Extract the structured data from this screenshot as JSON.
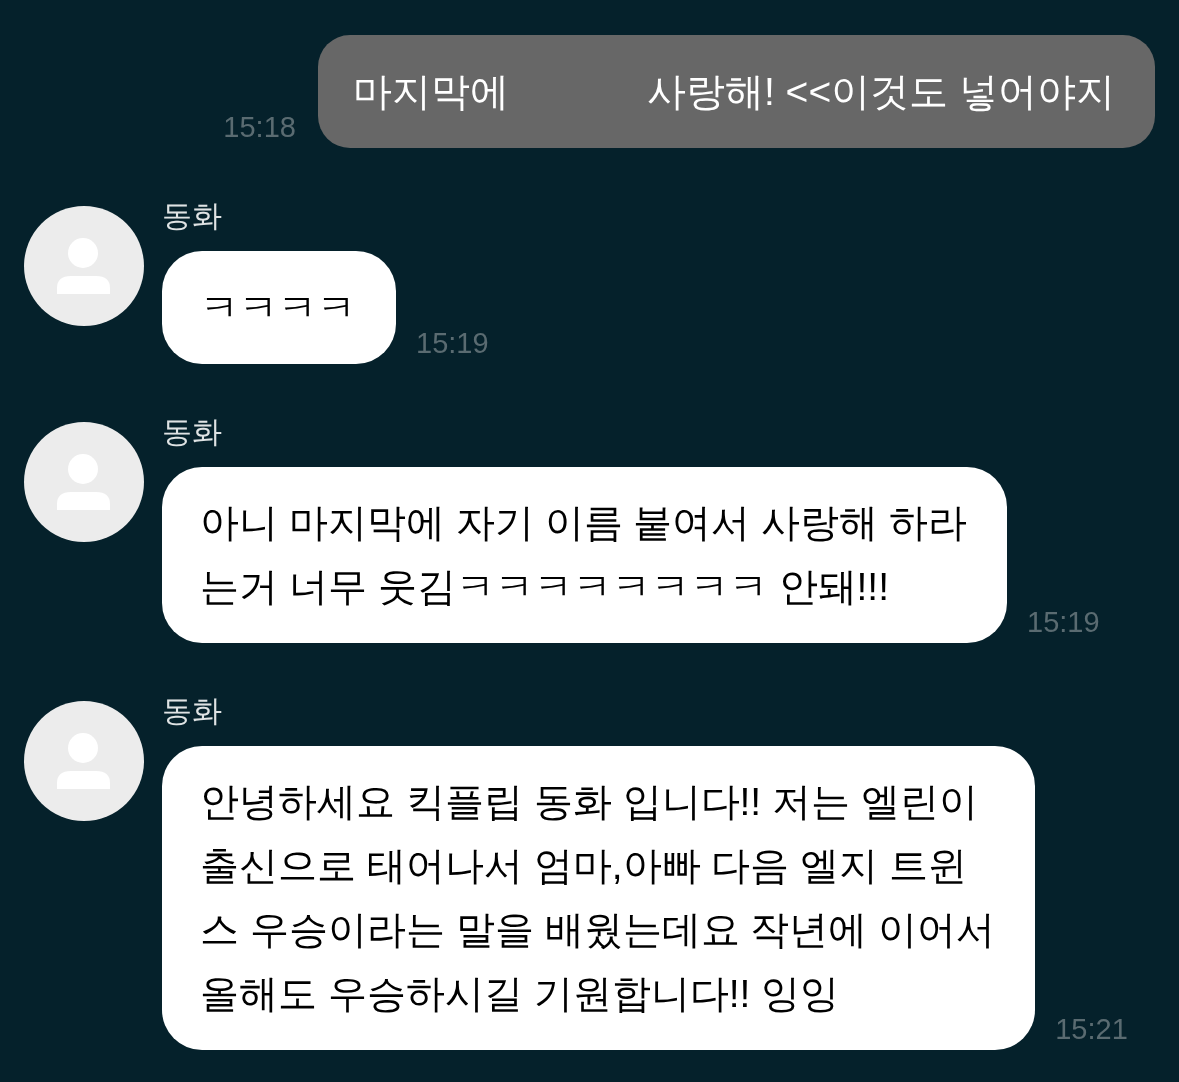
{
  "messages": [
    {
      "kind": "sent",
      "segments": [
        "마지막에",
        "사랑해! <<이것도 넣어야지"
      ],
      "time": "15:18"
    },
    {
      "kind": "received",
      "sender": "동화",
      "text": "ㅋㅋㅋㅋ",
      "time": "15:19"
    },
    {
      "kind": "received",
      "sender": "동화",
      "text": "아니 마지막에 자기 이름 붙여서 사랑해 하라\n는거 너무 웃김ㅋㅋㅋㅋㅋㅋㅋㅋ 안돼!!!",
      "time": "15:19"
    },
    {
      "kind": "received",
      "sender": "동화",
      "text": "안녕하세요 킥플립 동화 입니다!! 저는 엘린이\n출신으로 태어나서 엄마,아빠 다음 엘지 트윈\n스 우승이라는 말을 배웠는데요 작년에 이어서\n올해도 우승하시길 기원합니다!! 잉잉",
      "time": "15:21"
    }
  ]
}
